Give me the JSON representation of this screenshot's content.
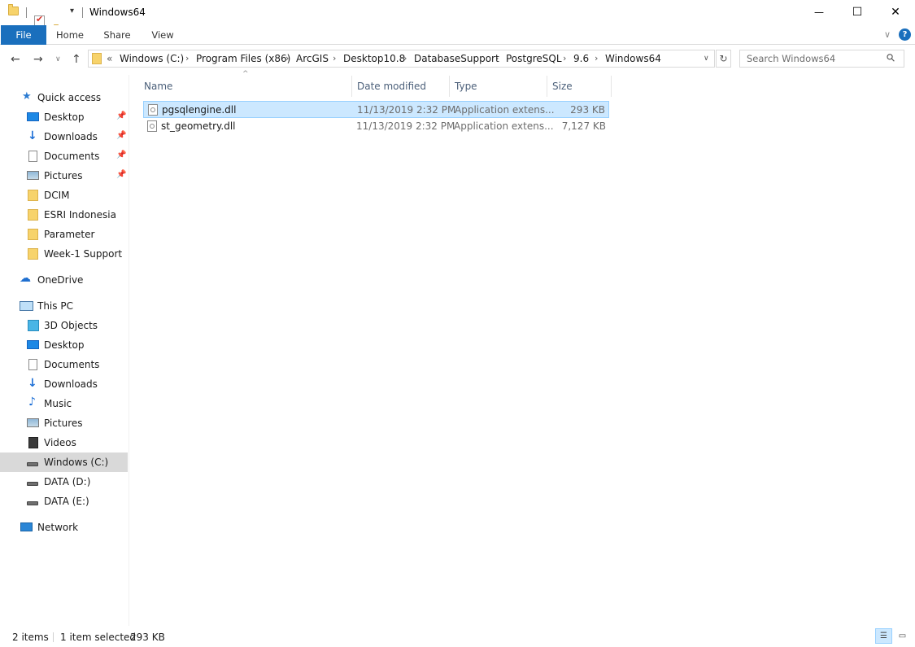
{
  "window": {
    "title": "Windows64",
    "minimize": "—",
    "maximize": "☐",
    "close": "✕"
  },
  "ribbon": {
    "tabs": [
      "File",
      "Home",
      "Share",
      "View"
    ],
    "expand_icon": "∨",
    "help_icon": "?"
  },
  "address": {
    "back": "←",
    "forward": "→",
    "recent": "∨",
    "up": "↑",
    "overflow": "«",
    "crumbs": [
      "Windows (C:)",
      "Program Files (x86)",
      "ArcGIS",
      "Desktop10.8",
      "DatabaseSupport",
      "PostgreSQL",
      "9.6",
      "Windows64"
    ],
    "separator": "›",
    "dropdown": "∨",
    "refresh": "↻"
  },
  "search": {
    "placeholder": "Search Windows64",
    "icon": "⚲"
  },
  "nav": {
    "quick_access": "Quick access",
    "quick_items": [
      "Desktop",
      "Downloads",
      "Documents",
      "Pictures",
      "DCIM",
      "ESRI Indonesia",
      "Parameter",
      "Week-1 Support"
    ],
    "pin": "📌",
    "onedrive": "OneDrive",
    "this_pc": "This PC",
    "pc_items": [
      "3D Objects",
      "Desktop",
      "Documents",
      "Downloads",
      "Music",
      "Pictures",
      "Videos",
      "Windows (C:)",
      "DATA (D:)",
      "DATA (E:)"
    ],
    "network": "Network"
  },
  "columns": {
    "name": "Name",
    "date": "Date modified",
    "type": "Type",
    "size": "Size",
    "sort_arrow": "^"
  },
  "files": [
    {
      "name": "pgsqlengine.dll",
      "date": "11/13/2019 2:32 PM",
      "type": "Application extens...",
      "size": "293 KB"
    },
    {
      "name": "st_geometry.dll",
      "date": "11/13/2019 2:32 PM",
      "type": "Application extens...",
      "size": "7,127 KB"
    }
  ],
  "status": {
    "count": "2 items",
    "selected": "1 item selected",
    "selected_size": "293 KB"
  },
  "colors": {
    "file_tab": "#1a6fbd",
    "selection": "#cce8ff",
    "nav_selected": "#d9d9d9"
  }
}
